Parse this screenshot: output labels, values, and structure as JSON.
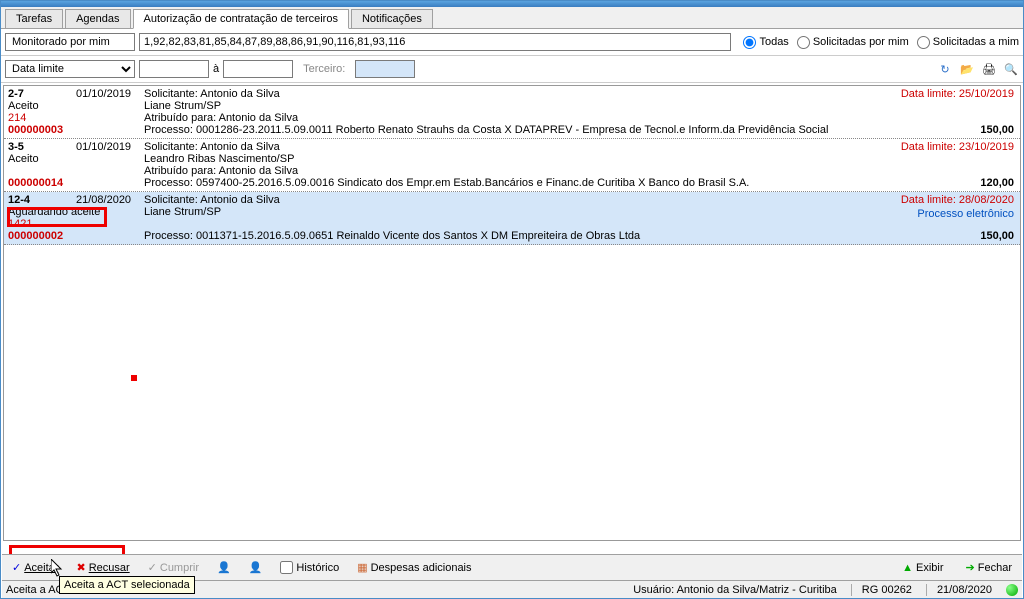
{
  "tabs": [
    "Tarefas",
    "Agendas",
    "Autorização de contratação de terceiros",
    "Notificações"
  ],
  "activeTab": 2,
  "filter": {
    "label": "Monitorado por mim",
    "value": "1,92,82,83,81,85,84,87,89,88,86,91,90,116,81,93,116",
    "radios": [
      "Todas",
      "Solicitadas por mim",
      "Solicitadas a mim"
    ],
    "radioSel": 0
  },
  "filter2": {
    "combo": "Data limite",
    "dateSep": "à",
    "terceiroLabel": "Terceiro:"
  },
  "rows": [
    {
      "col1a": "2-7",
      "col1b": "Aceito",
      "col1c": "214",
      "col1d": "000000003",
      "date": "01/10/2019",
      "l1": "Solicitante: Antonio da Silva",
      "l2": "Liane Strum/SP",
      "l3": "Atribuído para: Antonio da Silva",
      "l4": "Processo: 0001286-23.2011.5.09.0011  Roberto Renato Strauhs da Costa X DATAPREV - Empresa de Tecnol.e Inform.da Previdência Social",
      "limit": "Data limite: 25/10/2019",
      "amount": "150,00"
    },
    {
      "col1a": "3-5",
      "col1b": "Aceito",
      "col1c": "",
      "col1d": "000000014",
      "date": "01/10/2019",
      "l1": "Solicitante: Antonio da Silva",
      "l2": "Leandro Ribas Nascimento/SP",
      "l3": "Atribuído para: Antonio da Silva",
      "l4": "Processo: 0597400-25.2016.5.09.0016  Sindicato dos Empr.em Estab.Bancários e Financ.de Curitiba X Banco do Brasil S.A.",
      "limit": "Data limite: 23/10/2019",
      "amount": "120,00"
    },
    {
      "col1a": "12-4",
      "col1b": "Aguardando aceite",
      "col1c": "1421",
      "col1d": "000000002",
      "date": "21/08/2020",
      "l1": "Solicitante: Antonio da Silva",
      "l2": "Liane Strum/SP",
      "l3": "",
      "l4": "Processo: 0011371-15.2016.5.09.0651  Reinaldo Vicente dos Santos X DM Empreiteira de Obras Ltda",
      "limit": "Data limite: 28/08/2020",
      "elec": "Processo eletrônico",
      "amount": "150,00",
      "selected": true
    }
  ],
  "toolbar": {
    "aceitar": "Aceitar",
    "recusar": "Recusar",
    "cumprir": "Cumprir",
    "historico": "Histórico",
    "despesas": "Despesas adicionais",
    "exibir": "Exibir",
    "fechar": "Fechar"
  },
  "status": {
    "left": "Aceita a AC",
    "tooltip": "Aceita a ACT selecionada",
    "user": "Usuário: Antonio da Silva/Matriz - Curitiba",
    "rg": "RG 00262",
    "date": "21/08/2020"
  }
}
